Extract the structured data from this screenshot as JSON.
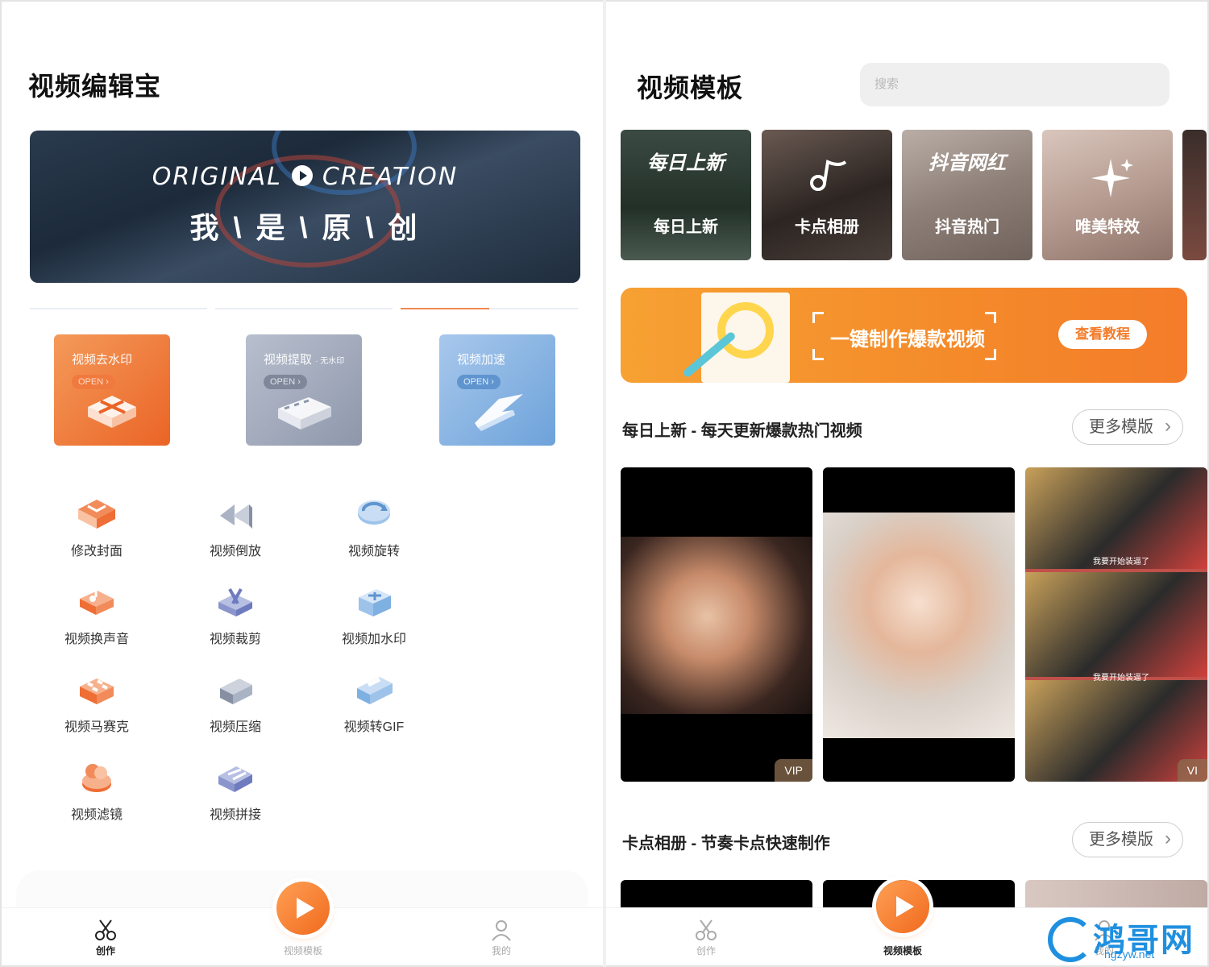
{
  "left": {
    "title": "视频编辑宝",
    "banner": {
      "en_left": "ORIGINAL",
      "en_right": "CREATION",
      "zh": "我 \\ 是 \\ 原 \\ 创"
    },
    "cards": [
      {
        "title": "视频去水印",
        "sub": "",
        "open": "OPEN ›"
      },
      {
        "title": "视频提取",
        "sub": "· 无水印",
        "open": "OPEN ›"
      },
      {
        "title": "视频加速",
        "sub": "",
        "open": "OPEN ›"
      }
    ],
    "tools": [
      {
        "label": "修改封面",
        "icon": "cover-icon"
      },
      {
        "label": "视频倒放",
        "icon": "rewind-icon"
      },
      {
        "label": "视频旋转",
        "icon": "rotate-icon"
      },
      {
        "label": "视频换声音",
        "icon": "audio-icon"
      },
      {
        "label": "视频裁剪",
        "icon": "scissors-icon"
      },
      {
        "label": "视频加水印",
        "icon": "watermark-icon"
      },
      {
        "label": "视频马赛克",
        "icon": "mosaic-icon"
      },
      {
        "label": "视频压缩",
        "icon": "compress-icon"
      },
      {
        "label": "视频转GIF",
        "icon": "gif-icon"
      },
      {
        "label": "视频滤镜",
        "icon": "filter-icon"
      },
      {
        "label": "视频拼接",
        "icon": "splice-icon"
      }
    ],
    "nav": {
      "create": "创作",
      "templates": "视频模板",
      "mine": "我的"
    }
  },
  "right": {
    "title": "视频模板",
    "search_placeholder": "搜索",
    "categories": [
      {
        "big": "每日上新",
        "label": "每日上新"
      },
      {
        "big": "",
        "label": "卡点相册"
      },
      {
        "big": "抖音网红",
        "label": "抖音热门"
      },
      {
        "big": "",
        "label": "唯美特效"
      }
    ],
    "promo": {
      "text": "一键制作爆款视频",
      "button": "查看教程"
    },
    "section1": {
      "title": "每日上新 - 每天更新爆款热门视频",
      "more": "更多模版",
      "vip": "VIP",
      "vip2": "VI",
      "caption": "我要开始装逼了"
    },
    "section2": {
      "title": "卡点相册 - 节奏卡点快速制作",
      "more": "更多模版"
    },
    "nav": {
      "create": "创作",
      "templates": "视频模板",
      "mine": "我的"
    }
  },
  "watermark": {
    "name": "鸿哥网",
    "url": "hgzyw.net"
  },
  "colors": {
    "accent": "#f06a1d",
    "orange_card": "#ea6426",
    "gray_card": "#8e97ab",
    "blue_card": "#6da2da",
    "watermark": "#1f8fe0"
  }
}
